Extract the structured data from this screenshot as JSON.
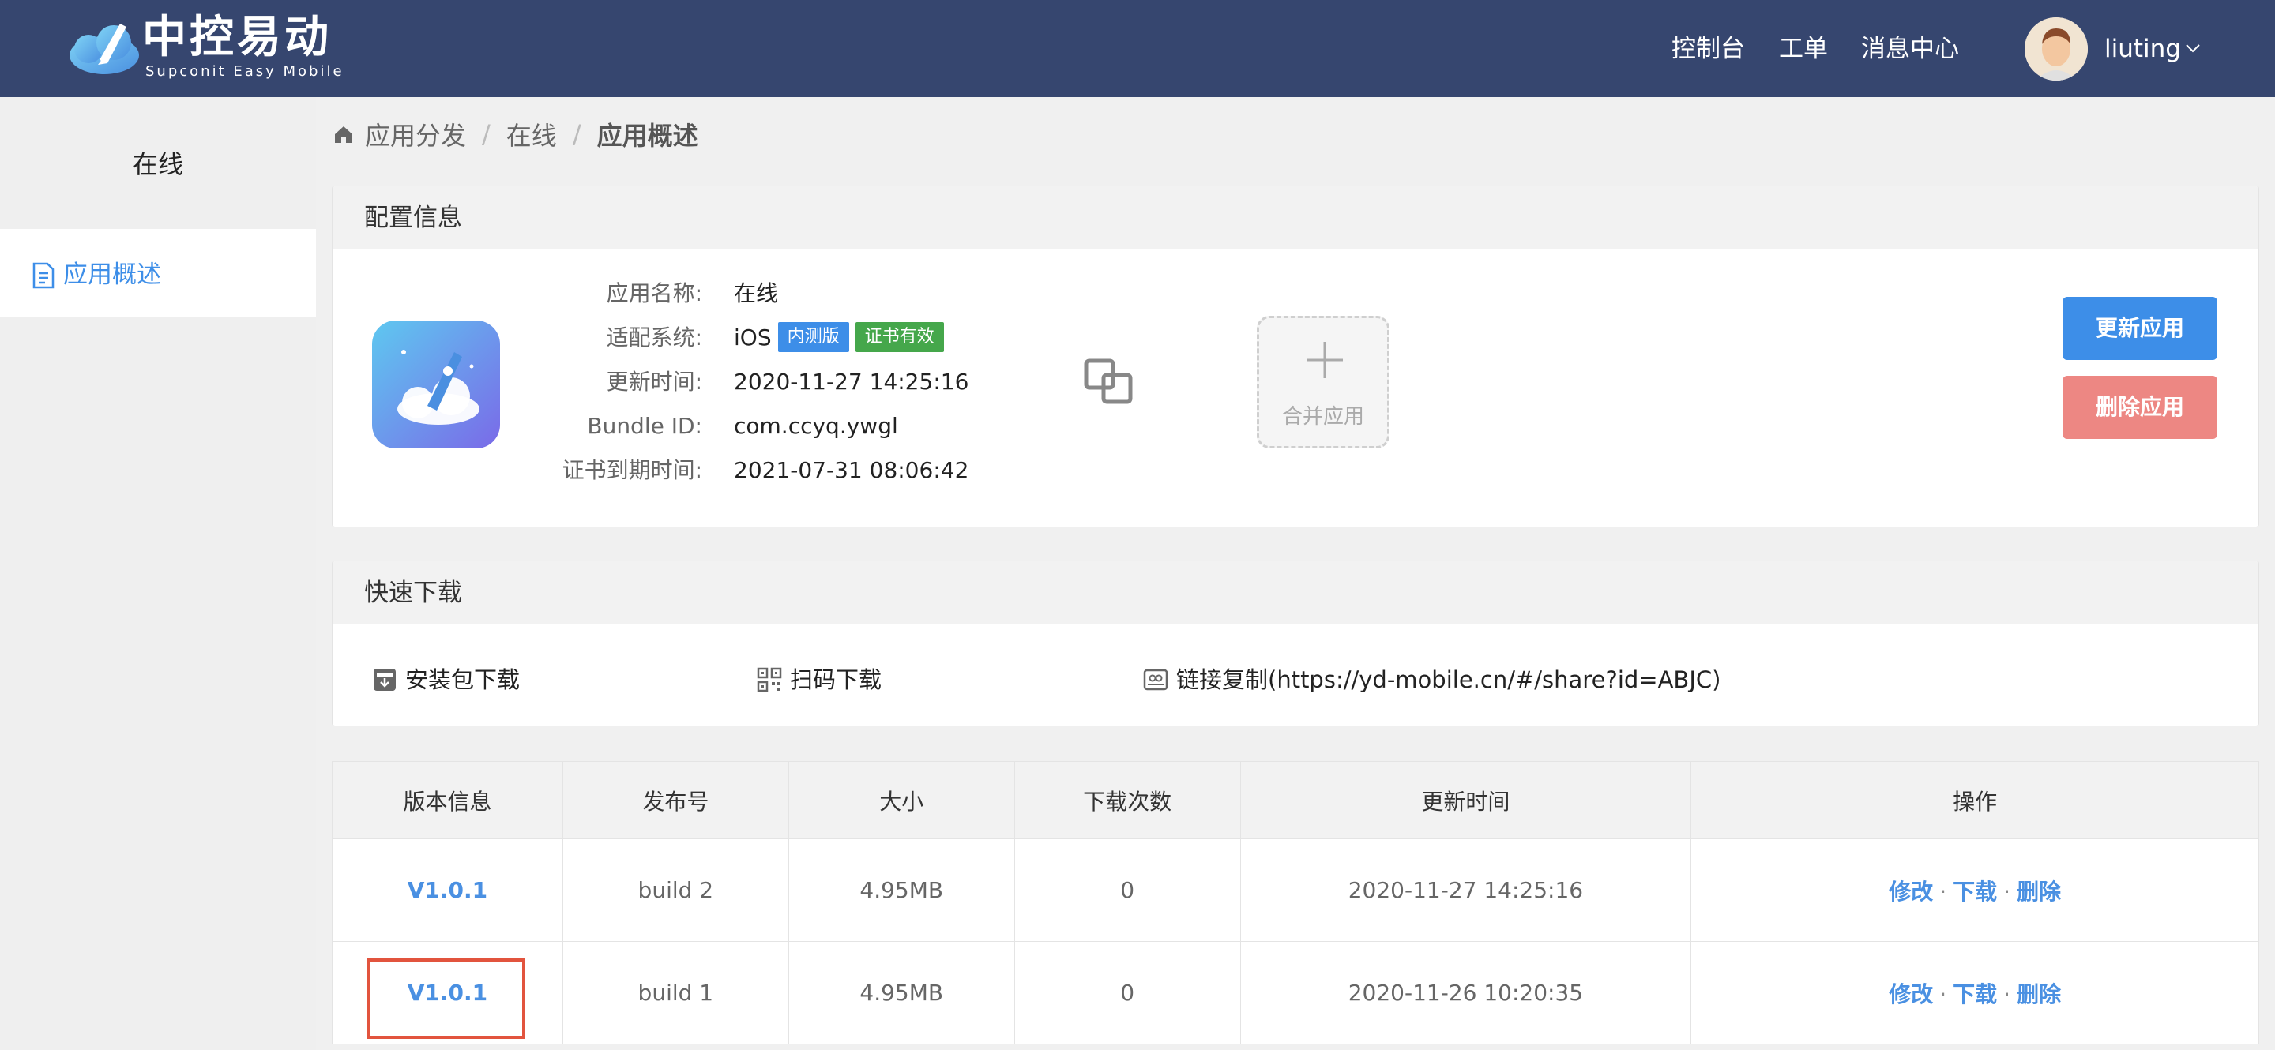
{
  "header": {
    "logo_cn": "中控易动",
    "logo_en": "Supconit Easy Mobile",
    "nav": [
      "控制台",
      "工单",
      "消息中心"
    ],
    "username": "liuting"
  },
  "sidebar": {
    "title": "在线",
    "items": [
      {
        "label": "应用概述",
        "icon": "document-icon",
        "active": true
      }
    ]
  },
  "breadcrumb": [
    "应用分发",
    "在线",
    "应用概述"
  ],
  "config": {
    "title": "配置信息",
    "rows": [
      {
        "label": "应用名称:",
        "value": "在线"
      },
      {
        "label": "适配系统:",
        "value": "iOS"
      },
      {
        "label": "更新时间:",
        "value": "2020-11-27 14:25:16"
      },
      {
        "label": "Bundle ID:",
        "value": "com.ccyq.ywgl"
      },
      {
        "label": "证书到期时间:",
        "value": "2021-07-31 08:06:42"
      }
    ],
    "tags": [
      "内测版",
      "证书有效"
    ],
    "merge_label": "合并应用",
    "buttons": {
      "update": "更新应用",
      "delete": "删除应用"
    }
  },
  "quick_download": {
    "title": "快速下载",
    "items": [
      {
        "label": "安装包下载",
        "icon": "package-icon"
      },
      {
        "label": "扫码下载",
        "icon": "qrcode-icon"
      },
      {
        "label": "链接复制(https://yd-mobile.cn/#/share?id=ABJC)",
        "icon": "link-copy-icon"
      }
    ]
  },
  "versions": {
    "columns": [
      "版本信息",
      "发布号",
      "大小",
      "下载次数",
      "更新时间",
      "操作"
    ],
    "rows": [
      {
        "version": "V1.0.1",
        "build": "build 2",
        "size": "4.95MB",
        "downloads": "0",
        "updated": "2020-11-27 14:25:16"
      },
      {
        "version": "V1.0.1",
        "build": "build 1",
        "size": "4.95MB",
        "downloads": "0",
        "updated": "2020-11-26 10:20:35"
      }
    ],
    "actions": [
      "修改",
      "下载",
      "删除"
    ],
    "action_sep": "·"
  },
  "colors": {
    "topbar": "#36466f",
    "accent": "#3d8ee8",
    "danger": "#ed8783",
    "highlight": "#e2543e"
  }
}
